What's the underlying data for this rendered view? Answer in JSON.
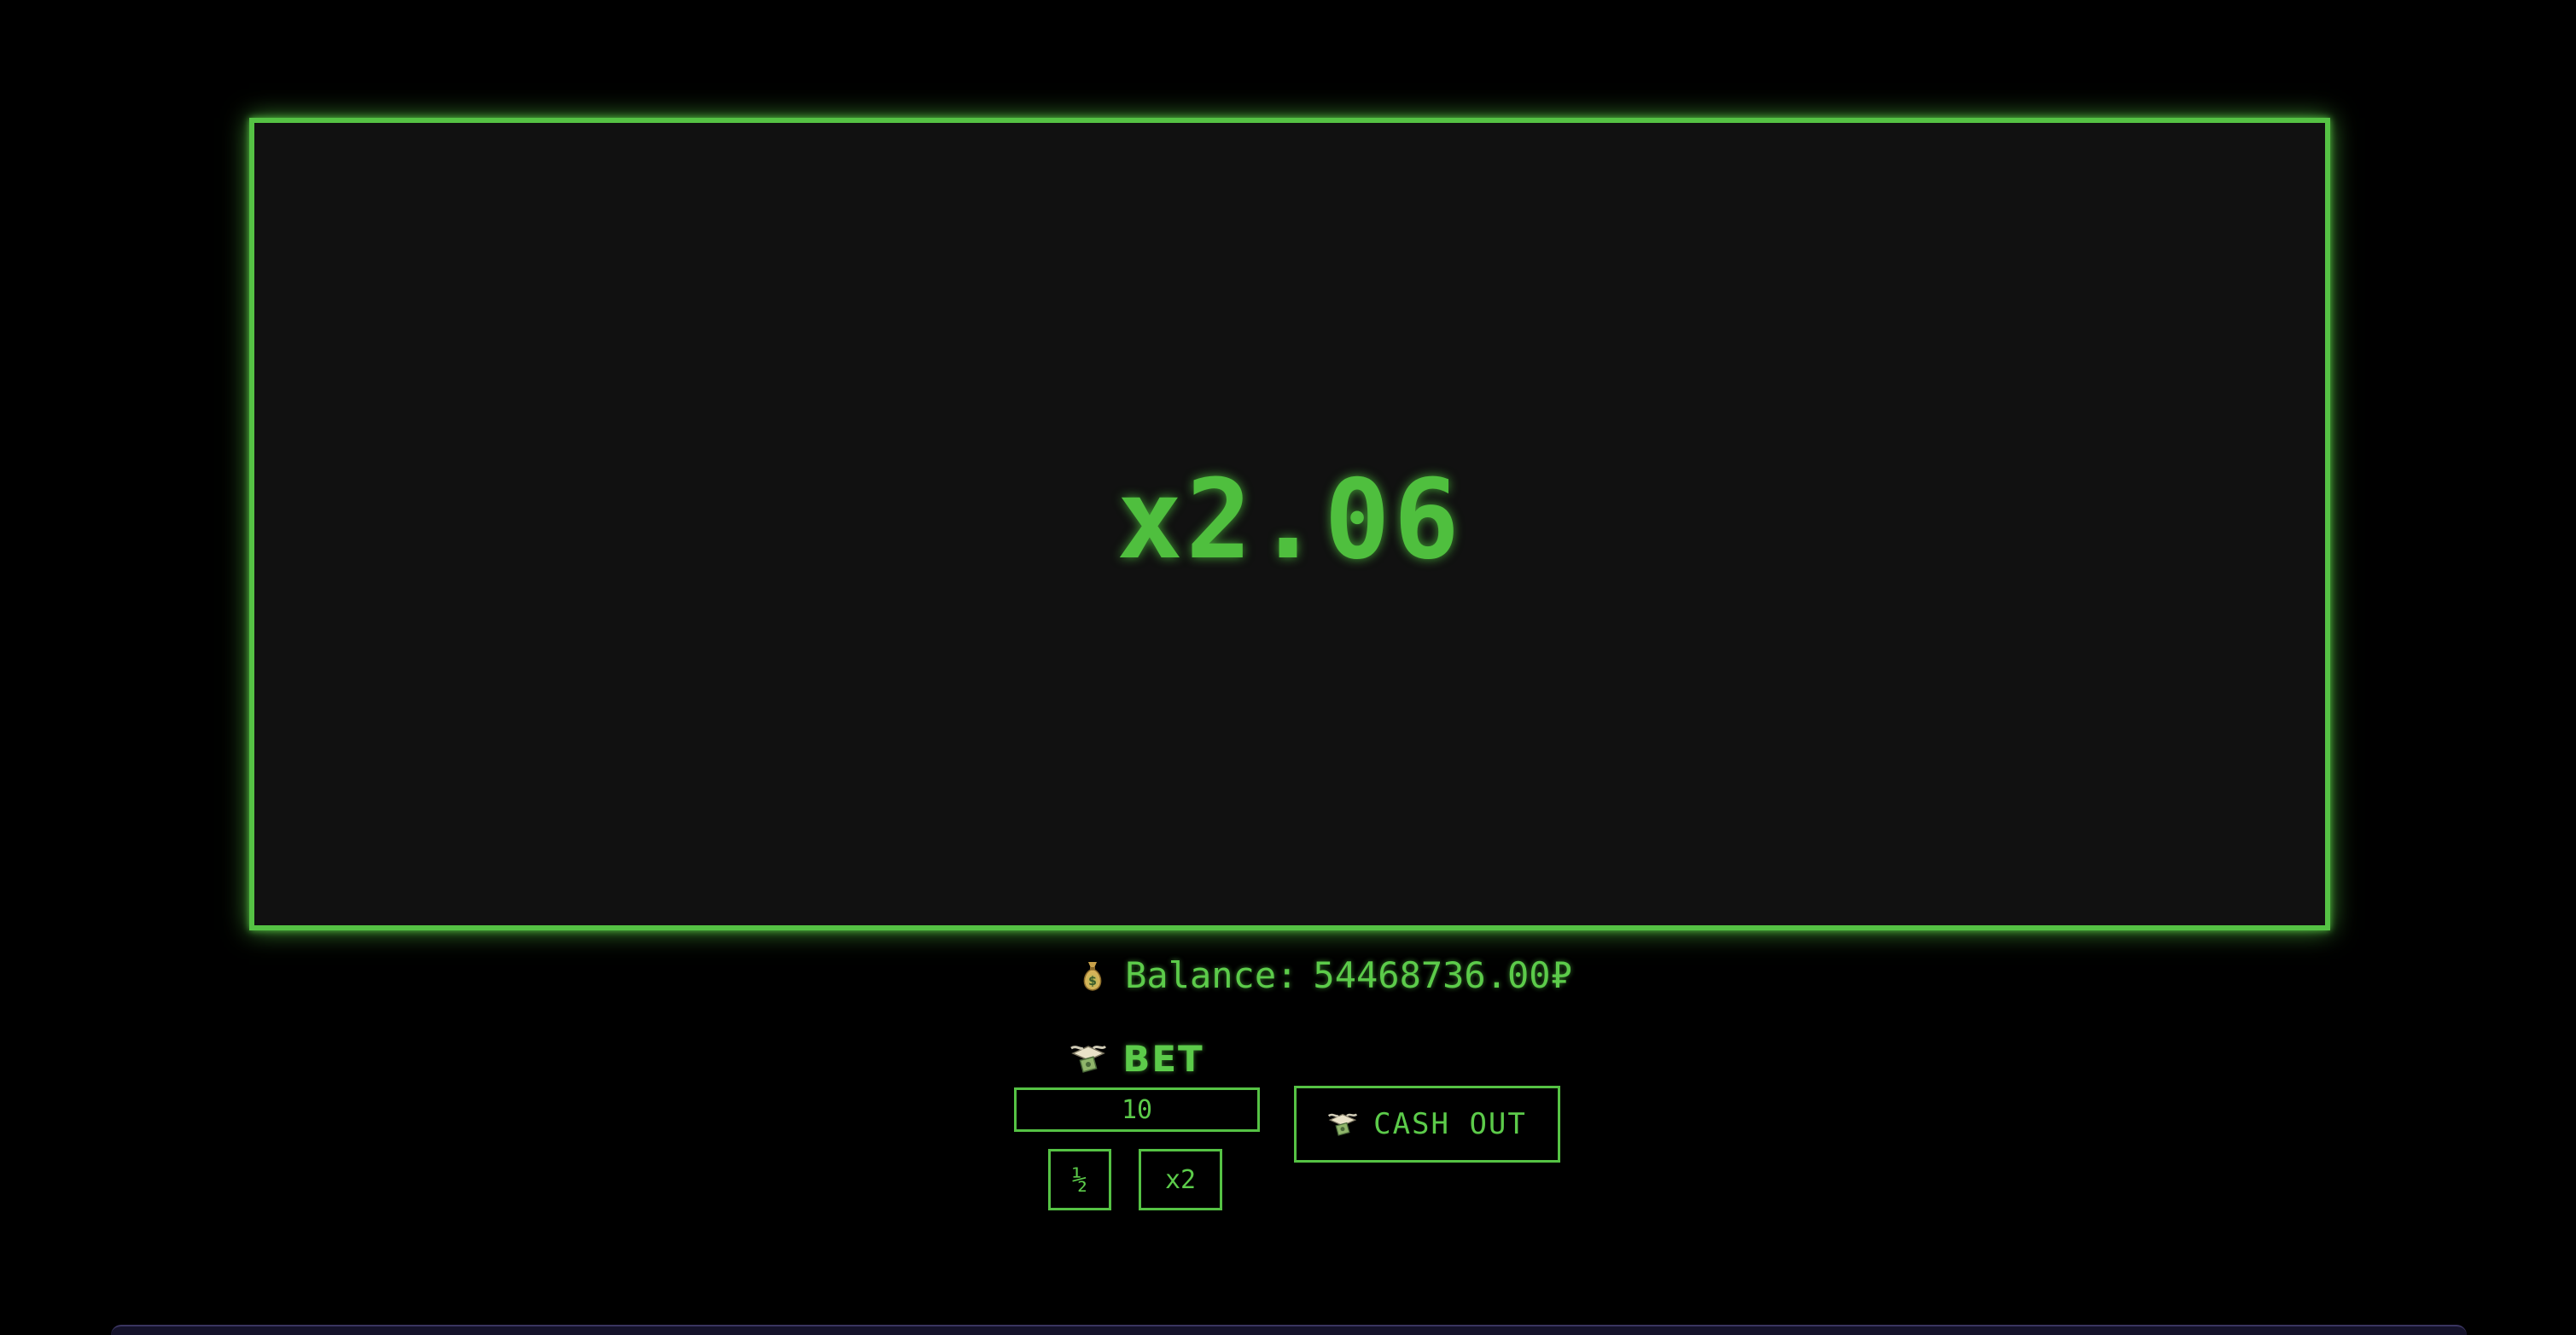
{
  "game": {
    "multiplier": "x2.06"
  },
  "balance": {
    "icon": "money-bag-icon",
    "label": "Balance:",
    "amount": "54468736.00₽"
  },
  "bet": {
    "icon": "flying-money-icon",
    "label": "BET",
    "value": "10",
    "half_label": "½",
    "double_label": "x2"
  },
  "cashout": {
    "icon": "flying-money-icon",
    "label": "CASH OUT"
  },
  "colors": {
    "accent": "#55c244",
    "text": "#5ccb4a",
    "screen_bg": "#111111",
    "page_bg": "#000000"
  }
}
